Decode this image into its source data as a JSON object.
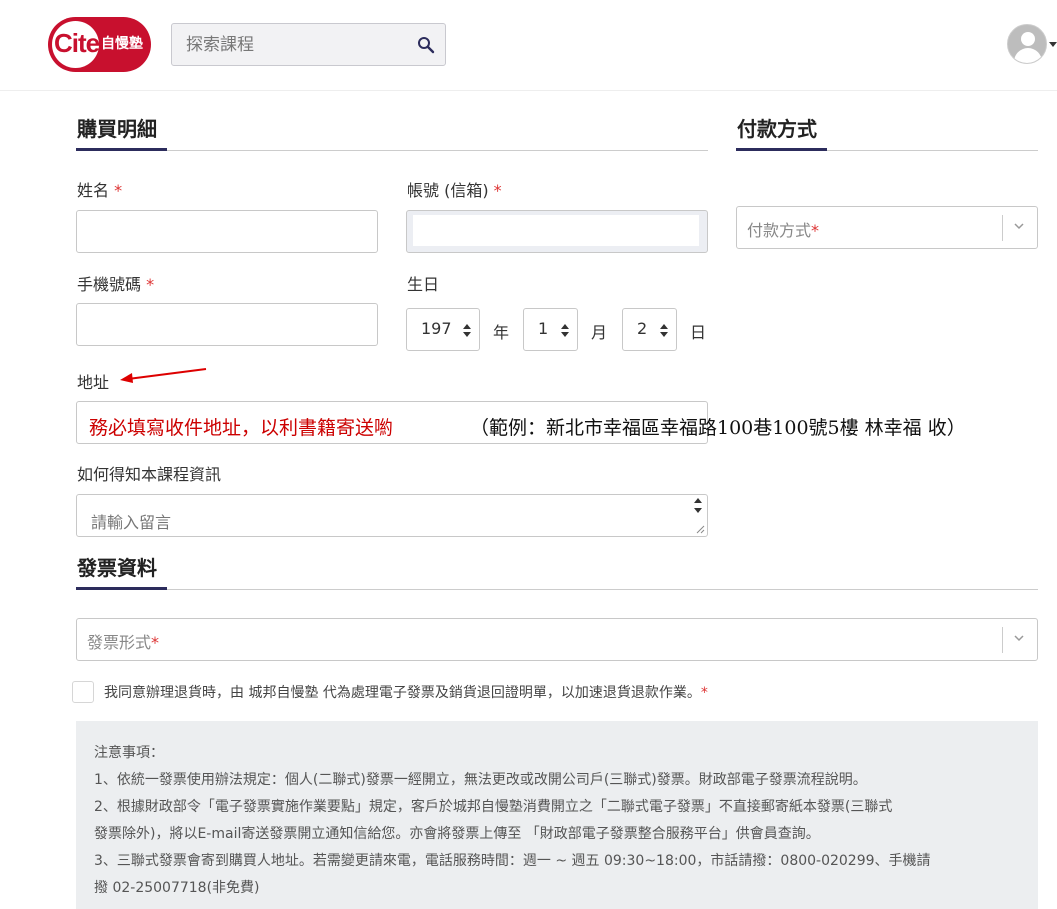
{
  "header": {
    "logo_brand": "Cite",
    "logo_text": "自慢塾",
    "search_placeholder": "探索課程",
    "search_icon": "search-icon",
    "avatar_icon": "user-avatar-icon"
  },
  "purchase": {
    "title": "購買明細",
    "name_label": "姓名",
    "account_label": "帳號 (信箱)",
    "phone_label": "手機號碼",
    "birthday_label": "生日",
    "birthday": {
      "year": "197",
      "year_unit": "年",
      "month": "1",
      "month_unit": "月",
      "day": "2",
      "day_unit": "日"
    },
    "address_label": "地址",
    "address_note_red": "務必填寫收件地址，以利書籍寄送喲",
    "address_note_example": "（範例：新北市幸福區幸福路100巷100號5樓 林幸福 收）",
    "source_label": "如何得知本課程資訊",
    "message_placeholder": "請輸入留言",
    "required_mark": "*"
  },
  "payment": {
    "title": "付款方式",
    "select_placeholder": "付款方式"
  },
  "invoice": {
    "title": "發票資料",
    "select_placeholder": "發票形式",
    "agree_text": "我同意辦理退貨時，由 城邦自慢塾 代為處理電子發票及銷貨退回證明單，以加速退貨退款作業。"
  },
  "notice": {
    "lines": [
      "注意事項：",
      "1、依統一發票使用辦法規定：個人(二聯式)發票一經開立，無法更改或改開公司戶(三聯式)發票。財政部電子發票流程說明。",
      "2、根據財政部令「電子發票實施作業要點」規定，客戶於城邦自慢塾消費開立之「二聯式電子發票」不直接郵寄紙本發票(三聯式",
      "發票除外)，將以E-mail寄送發票開立通知信給您。亦會將發票上傳至 「財政部電子發票整合服務平台」供會員查詢。",
      "3、三聯式發票會寄到購買人地址。若需變更請來電，電話服務時間：週一 ~ 週五 09:30~18:00，市話請撥：0800-020299、手機請",
      "撥 02-25007718(非免費)"
    ]
  },
  "colors": {
    "brand": "#c8102e",
    "accent": "#2c2c5c",
    "note_red": "#cc0000"
  }
}
